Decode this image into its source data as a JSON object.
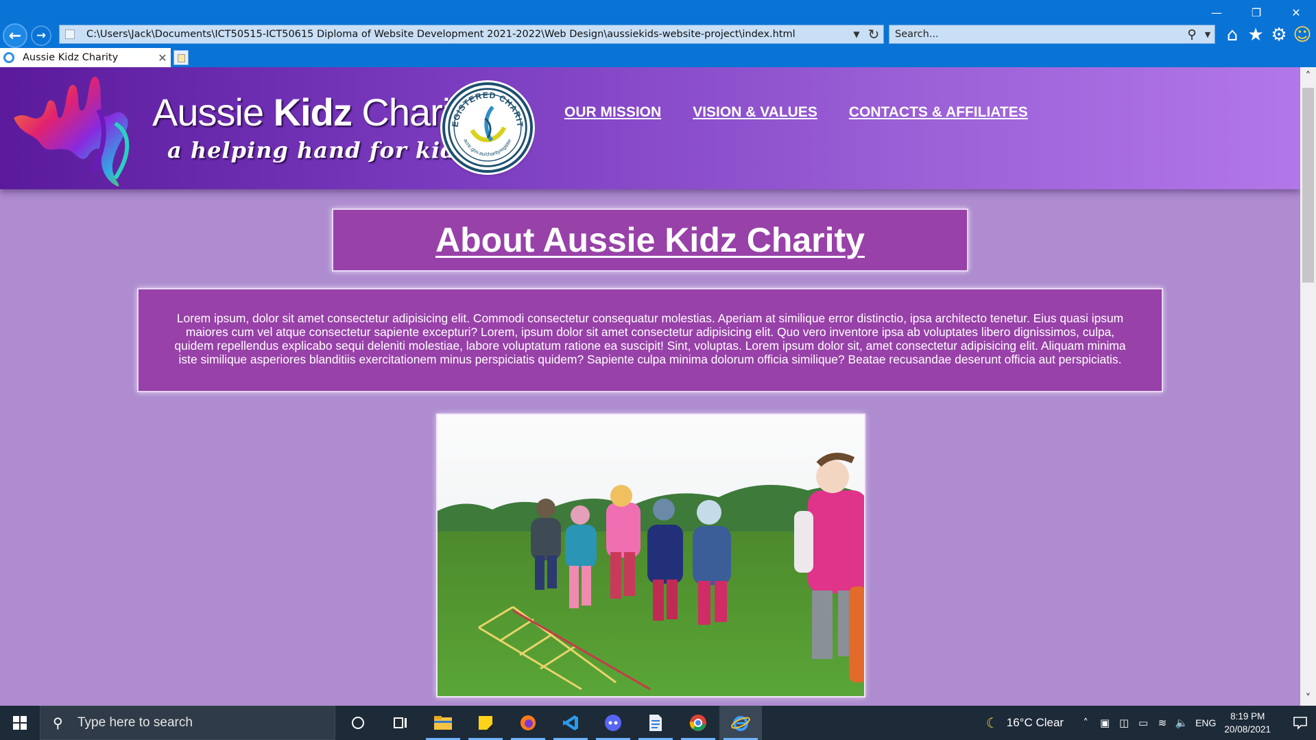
{
  "browser": {
    "address": "C:\\Users\\Jack\\Documents\\ICT50515-ICT50615 Diploma of Website Development 2021-2022\\Web Design\\aussiekids-website-project\\index.html",
    "search_placeholder": "Search...",
    "tab_title": "Aussie Kidz Charity",
    "accent": "#0a73d6"
  },
  "site": {
    "brand": {
      "word1": "Aussie ",
      "word2": "Kidz",
      "word3": " Charity",
      "tagline": "a helping hand for kidz"
    },
    "acnc": {
      "top": "REGISTERED CHARITY",
      "bottom": "acnc.gov.au/charityregister"
    },
    "nav": [
      "OUR MISSION",
      "VISION & VALUES",
      "CONTACTS & AFFILIATES"
    ],
    "about_title": "About Aussie Kidz Charity",
    "about_text": "Lorem ipsum, dolor sit amet consectetur adipisicing elit. Commodi consectetur consequatur molestias. Aperiam at similique error distinctio, ipsa architecto tenetur. Eius quasi ipsum maiores cum vel atque consectetur sapiente excepturi? Lorem, ipsum dolor sit amet consectetur adipisicing elit. Quo vero inventore ipsa ab voluptates libero dignissimos, culpa, quidem repellendus explicabo sequi deleniti molestiae, labore voluptatum ratione ea suscipit! Sint, voluptas. Lorem ipsum dolor sit, amet consectetur adipisicing elit. Aliquam minima iste similique asperiores blanditiis exercitationem minus perspiciatis quidem? Sapiente culpa minima dolorum officia similique? Beatae recusandae deserunt officia aut perspiciatis.",
    "colors": {
      "header_start": "#5b1a9c",
      "header_end": "#b277e9",
      "page_bg": "#ae8ccf",
      "box_bg": "#9841a9"
    }
  },
  "taskbar": {
    "search_placeholder": "Type here to search",
    "weather": "16°C  Clear",
    "language": "ENG",
    "time": "8:19 PM",
    "date": "20/08/2021"
  }
}
